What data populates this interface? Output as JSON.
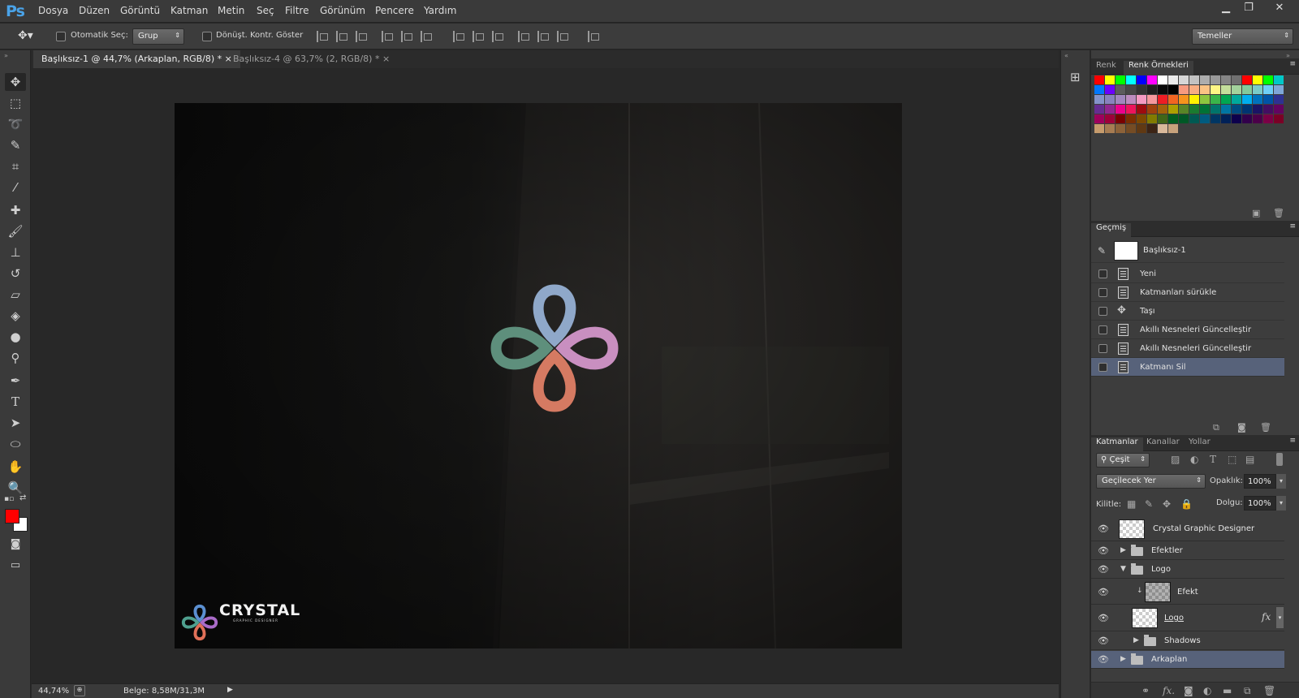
{
  "app": {
    "logo": "Ps"
  },
  "menu": [
    "Dosya",
    "Düzen",
    "Görüntü",
    "Katman",
    "Metin",
    "Seç",
    "Filtre",
    "Görünüm",
    "Pencere",
    "Yardım"
  ],
  "options": {
    "auto_select_label": "Otomatik Seç:",
    "auto_select_value": "Grup",
    "transform_controls_label": "Dönüşt. Kontr. Göster",
    "workspace_value": "Temeller"
  },
  "documents": {
    "tab1": "Başlıksız-1 @ 44,7% (Arkaplan, RGB/8) *",
    "tab2": "Başlıksız-4 @ 63,7% (2, RGB/8) *",
    "close": "×"
  },
  "canvas": {
    "brand_name": "CRYSTAL",
    "brand_sub": "GRAPHIC DESIGNER"
  },
  "status": {
    "zoom": "44,74%",
    "doc_size": "Belge: 8,58M/31,3M"
  },
  "colors": {
    "foreground": "#ff0000",
    "background": "#ffffff"
  },
  "swatches_panel": {
    "tabs": [
      "Renk",
      "Renk Örnekleri"
    ],
    "swatches": [
      "#ff0000",
      "#ffff00",
      "#00ff00",
      "#00ffff",
      "#0000ff",
      "#ff00ff",
      "#ffffff",
      "#ebebeb",
      "#d6d6d6",
      "#c2c2c2",
      "#adadad",
      "#999999",
      "#858585",
      "#707070",
      "#ff0000",
      "#ffff00",
      "#00ff00",
      "#00c8c8",
      "#0077ff",
      "#6b00ff",
      "#5c5c5c",
      "#474747",
      "#333333",
      "#1f1f1f",
      "#0a0a0a",
      "#000000",
      "#f79a7f",
      "#f8ad82",
      "#fbc384",
      "#fff685",
      "#c4df9b",
      "#a3d39c",
      "#82ca9c",
      "#7accc8",
      "#6ecff6",
      "#7ea7d8",
      "#8493ca",
      "#8882be",
      "#a187be",
      "#bd8cbf",
      "#f49ac2",
      "#f6989d",
      "#ee1d24",
      "#f26522",
      "#f7941d",
      "#fff200",
      "#8dc63f",
      "#39b54a",
      "#00a651",
      "#00a99d",
      "#00aeef",
      "#0072bc",
      "#0054a6",
      "#2e3192",
      "#662d91",
      "#92278f",
      "#ec008c",
      "#ed145b",
      "#9e0b0f",
      "#a0410d",
      "#a3620a",
      "#aba000",
      "#598527",
      "#1a7b30",
      "#007236",
      "#00746b",
      "#0076a3",
      "#004b80",
      "#003471",
      "#1b1464",
      "#440e62",
      "#630460",
      "#9e005d",
      "#9e0039",
      "#790000",
      "#7b2e00",
      "#7d4900",
      "#827b00",
      "#406618",
      "#005e20",
      "#005826",
      "#005952",
      "#005b7f",
      "#003663",
      "#002157",
      "#0d004c",
      "#32004b",
      "#4b0049",
      "#7b0046",
      "#7a0026",
      "#c69c6d",
      "#a67c52",
      "#8c6239",
      "#754c24",
      "#603913",
      "#3c2415",
      "#d9b99b",
      "#c7a27c"
    ]
  },
  "history_panel": {
    "tab": "Geçmiş",
    "snapshot": "Başlıksız-1",
    "items": [
      "Yeni",
      "Katmanları sürükle",
      "Taşı",
      "Akıllı Nesneleri Güncelleştir",
      "Akıllı Nesneleri Güncelleştir",
      "Katmanı Sil"
    ]
  },
  "layers_panel": {
    "tabs": [
      "Katmanlar",
      "Kanallar",
      "Yollar"
    ],
    "filter": "Çeşit",
    "blend_mode": "Geçilecek Yer",
    "opacity_label": "Opaklık:",
    "opacity": "100%",
    "lock_label": "Kilitle:",
    "fill_label": "Dolgu:",
    "fill": "100%",
    "fx": "fx",
    "layers": [
      "Crystal Graphic Designer",
      "Efektler",
      "Logo",
      "Efekt",
      "Logo",
      "Shadows",
      "Arkaplan"
    ]
  }
}
